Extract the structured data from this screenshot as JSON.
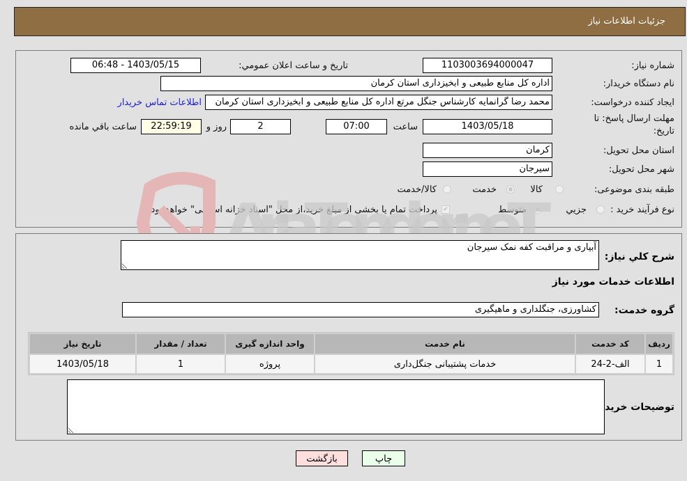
{
  "header": {
    "title": "جزئیات اطلاعات نیاز"
  },
  "info": {
    "need_number_label": "شماره نیاز:",
    "need_number": "1103003694000047",
    "announce_label": "تاریخ و ساعت اعلان عمومي:",
    "announce_value": "1403/05/15 - 06:48",
    "buyer_org_label": "نام دستگاه خریدار:",
    "buyer_org": "اداره کل منابع طبیعی و ابخیزداری استان کرمان",
    "creator_label": "ایجاد کننده درخواست:",
    "creator": "محمد رضا گرانمایه کارشناس جنگل مرتع اداره کل منابع طبیعی و ابخیزداری استان کرمان",
    "buyer_contact_link": "اطلاعات تماس خریدار",
    "deadline_label_line1": "مهلت ارسال پاسخ: تا",
    "deadline_label_line2": "تاریخ:",
    "deadline_date": "1403/05/18",
    "time_label": "ساعت",
    "deadline_time": "07:00",
    "days_value": "2",
    "days_label": "روز و",
    "remaining_time": "22:59:19",
    "remaining_label": "ساعت باقي مانده",
    "province_label": "استان محل تحویل:",
    "province": "کرمان",
    "city_label": "شهر محل تحویل:",
    "city": "سیرجان",
    "category_label": "طبقه بندی موضوعی:",
    "category_options": [
      {
        "label": "کالا",
        "selected": false
      },
      {
        "label": "خدمت",
        "selected": true
      },
      {
        "label": "کالا/خدمت",
        "selected": false
      }
    ],
    "process_label": "نوع فرآیند خرید :",
    "process_options": [
      {
        "label": "جزيي",
        "selected": false
      },
      {
        "label": "متوسط",
        "selected": true
      }
    ],
    "treasury_checked": true,
    "treasury_note": "پرداخت تمام یا بخشی از مبلغ خرید،از محل \"اسناد خزانه اسلامی\" خواهد بود."
  },
  "details": {
    "description_label": "شرح کلي نیاز:",
    "description": "آبیاری و مراقبت کفه نمک سیرجان",
    "services_heading": "اطلاعات خدمات مورد نیاز",
    "service_group_label": "گروه خدمت:",
    "service_group": "کشاورزی، جنگلداری و ماهیگیری",
    "table": {
      "headers": [
        "ردیف",
        "کد خدمت",
        "نام خدمت",
        "واحد اندازه گیری",
        "تعداد / مقدار",
        "تاریخ نیاز"
      ],
      "rows": [
        [
          "1",
          "الف-2-24",
          "خدمات پشتیبانی جنگل‌داری",
          "پروژه",
          "1",
          "1403/05/18"
        ]
      ]
    },
    "buyer_notes_label": "توضیحات خریدار:",
    "buyer_notes": ""
  },
  "buttons": {
    "print": "چاپ",
    "back": "بازگشت"
  },
  "colors": {
    "header_bg": "#8e6e42",
    "print_bg": "#eaffea",
    "back_bg": "#ffdede",
    "link": "#1b1bd6"
  },
  "watermark": {
    "text": "AriaTender.neT"
  }
}
